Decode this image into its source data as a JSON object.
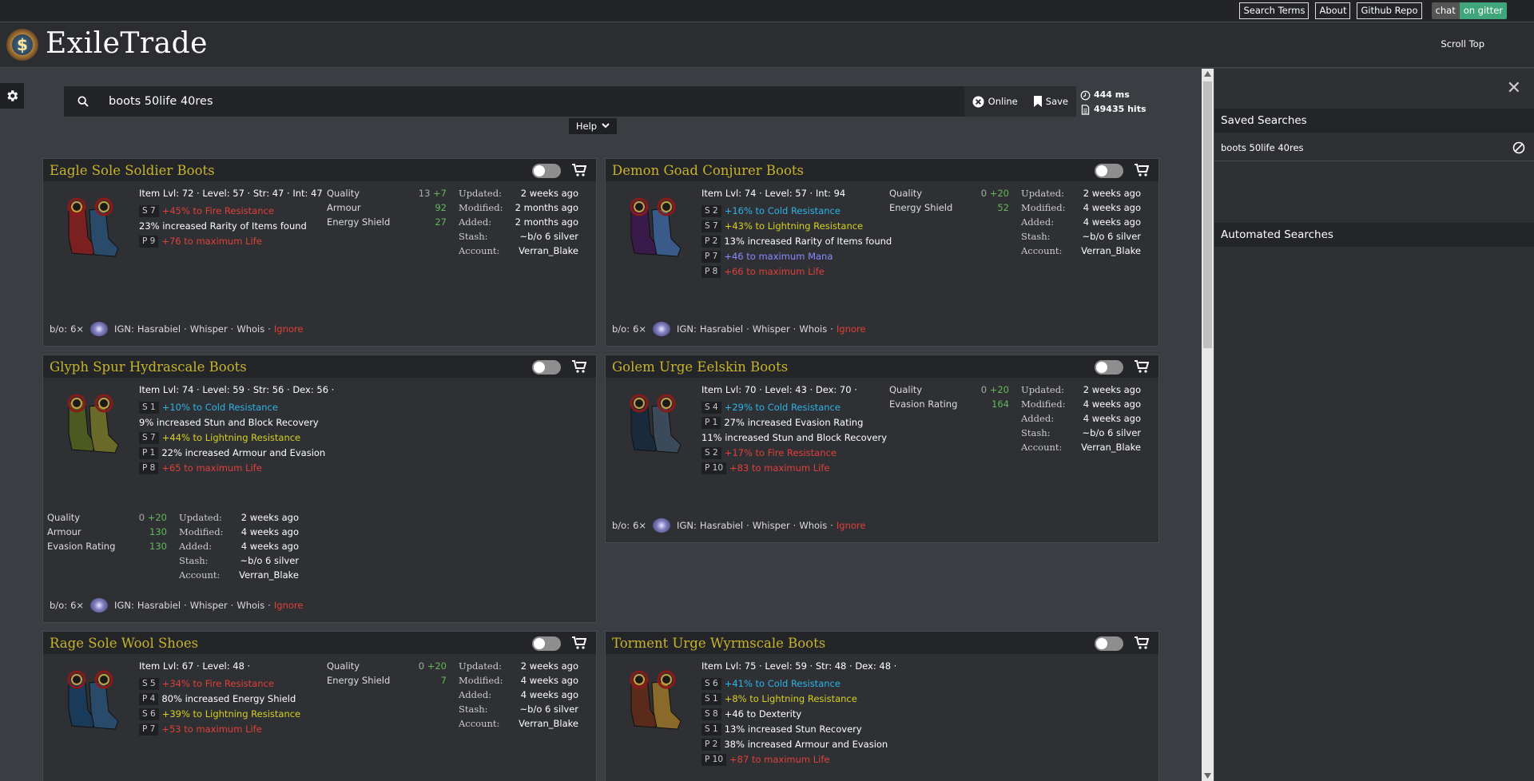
{
  "toplinks": [
    "Search Terms",
    "About",
    "Github Repo"
  ],
  "chat": {
    "left": "chat",
    "right": "on gitter"
  },
  "brand": "ExileTrade",
  "scroll_top": "Scroll Top",
  "search": {
    "value": "boots 50life 40res",
    "online_label": "Online",
    "save_label": "Save"
  },
  "stats": {
    "time": "444 ms",
    "hits": "49435 hits"
  },
  "help_label": "Help",
  "side": {
    "saved_title": "Saved Searches",
    "saved_item": "boots 50life 40res",
    "auto_title": "Automated Searches"
  },
  "colors": {
    "title": "#c8b42a",
    "fire": "#e0403a",
    "cold": "#2db4e8",
    "lightning": "#d8d020",
    "mana": "#8a8aff",
    "quality": "#62b85a"
  },
  "footer": {
    "bo": "b/o:",
    "qty": "6×",
    "ign_label": "IGN:",
    "ign": "Hasrabiel",
    "sep": "·",
    "whisper": "Whisper",
    "whois": "Whois",
    "ignore": "Ignore"
  },
  "cards": [
    {
      "title": "Eagle Sole Soldier Boots",
      "meta": "Item Lvl: 72 · Level: 57 · Str: 47 · Int: 47",
      "mods": [
        {
          "tag": "S 7",
          "text": "+45% to Fire Resistance",
          "cls": "c-fire"
        },
        {
          "tag": "",
          "text": "23% increased Rarity of Items found",
          "cls": "c-white"
        },
        {
          "tag": "P 9",
          "text": "+76 to maximum Life",
          "cls": "c-fire"
        }
      ],
      "quality": [
        {
          "k": "Quality",
          "base": "13",
          "v": "+7"
        },
        {
          "k": "Armour",
          "base": "",
          "v": "92"
        },
        {
          "k": "Energy Shield",
          "base": "",
          "v": "27"
        }
      ],
      "info": [
        {
          "k": "Updated:",
          "v": "2 weeks ago"
        },
        {
          "k": "Modified:",
          "v": "2 months ago"
        },
        {
          "k": "Added:",
          "v": "2 months ago"
        },
        {
          "k": "Stash:",
          "v": "~b/o 6 silver"
        },
        {
          "k": "Account:",
          "v": "Verran_Blake"
        }
      ]
    },
    {
      "title": "Demon Goad Conjurer Boots",
      "meta": "Item Lvl: 74 · Level: 57 · Int: 94",
      "mods": [
        {
          "tag": "S 2",
          "text": "+16% to Cold Resistance",
          "cls": "c-cold"
        },
        {
          "tag": "S 7",
          "text": "+43% to Lightning Resistance",
          "cls": "c-light"
        },
        {
          "tag": "P 2",
          "text": "13% increased Rarity of Items found",
          "cls": "c-white"
        },
        {
          "tag": "P 7",
          "text": "+46 to maximum Mana",
          "cls": "c-mana"
        },
        {
          "tag": "P 8",
          "text": "+66 to maximum Life",
          "cls": "c-fire"
        }
      ],
      "quality": [
        {
          "k": "Quality",
          "base": "0",
          "v": "+20"
        },
        {
          "k": "Energy Shield",
          "base": "",
          "v": "52"
        }
      ],
      "info": [
        {
          "k": "Updated:",
          "v": "2 weeks ago"
        },
        {
          "k": "Modified:",
          "v": "4 weeks ago"
        },
        {
          "k": "Added:",
          "v": "4 weeks ago"
        },
        {
          "k": "Stash:",
          "v": "~b/o 6 silver"
        },
        {
          "k": "Account:",
          "v": "Verran_Blake"
        }
      ]
    },
    {
      "title": "Glyph Spur Hydrascale Boots",
      "meta": "Item Lvl: 74 · Level: 59 · Str: 56 · Dex: 56 ·",
      "mods": [
        {
          "tag": "S 1",
          "text": "+10% to Cold Resistance",
          "cls": "c-cold"
        },
        {
          "tag": "",
          "text": "9% increased Stun and Block Recovery",
          "cls": "c-white"
        },
        {
          "tag": "S 7",
          "text": "+44% to Lightning Resistance",
          "cls": "c-light"
        },
        {
          "tag": "P 1",
          "text": "22% increased Armour and Evasion",
          "cls": "c-white"
        },
        {
          "tag": "P 8",
          "text": "+65 to maximum Life",
          "cls": "c-fire"
        }
      ],
      "quality": [
        {
          "k": "Quality",
          "base": "0",
          "v": "+20"
        },
        {
          "k": "Armour",
          "base": "",
          "v": "130"
        },
        {
          "k": "Evasion Rating",
          "base": "",
          "v": "130"
        }
      ],
      "info": [
        {
          "k": "Updated:",
          "v": "2 weeks ago"
        },
        {
          "k": "Modified:",
          "v": "4 weeks ago"
        },
        {
          "k": "Added:",
          "v": "4 weeks ago"
        },
        {
          "k": "Stash:",
          "v": "~b/o 6 silver"
        },
        {
          "k": "Account:",
          "v": "Verran_Blake"
        }
      ]
    },
    {
      "title": "Golem Urge Eelskin Boots",
      "meta": "Item Lvl: 70 · Level: 43 · Dex: 70 ·",
      "mods": [
        {
          "tag": "S 4",
          "text": "+29% to Cold Resistance",
          "cls": "c-cold"
        },
        {
          "tag": "P 1",
          "text": "27% increased Evasion Rating",
          "cls": "c-white"
        },
        {
          "tag": "",
          "text": "11% increased Stun and Block Recovery",
          "cls": "c-white"
        },
        {
          "tag": "S 2",
          "text": "+17% to Fire Resistance",
          "cls": "c-fire"
        },
        {
          "tag": "P 10",
          "text": "+83 to maximum Life",
          "cls": "c-fire"
        }
      ],
      "quality": [
        {
          "k": "Quality",
          "base": "0",
          "v": "+20"
        },
        {
          "k": "Evasion Rating",
          "base": "",
          "v": "164"
        }
      ],
      "info": [
        {
          "k": "Updated:",
          "v": "2 weeks ago"
        },
        {
          "k": "Modified:",
          "v": "4 weeks ago"
        },
        {
          "k": "Added:",
          "v": "4 weeks ago"
        },
        {
          "k": "Stash:",
          "v": "~b/o 6 silver"
        },
        {
          "k": "Account:",
          "v": "Verran_Blake"
        }
      ]
    },
    {
      "title": "Rage Sole Wool Shoes",
      "meta": "Item Lvl: 67 · Level: 48 ·",
      "mods": [
        {
          "tag": "S 5",
          "text": "+34% to Fire Resistance",
          "cls": "c-fire"
        },
        {
          "tag": "P 4",
          "text": "80% increased Energy Shield",
          "cls": "c-white"
        },
        {
          "tag": "S 6",
          "text": "+39% to Lightning Resistance",
          "cls": "c-light"
        },
        {
          "tag": "P 7",
          "text": "+53 to maximum Life",
          "cls": "c-fire"
        }
      ],
      "quality": [
        {
          "k": "Quality",
          "base": "0",
          "v": "+20"
        },
        {
          "k": "Energy Shield",
          "base": "",
          "v": "7"
        }
      ],
      "info": [
        {
          "k": "Updated:",
          "v": "2 weeks ago"
        },
        {
          "k": "Modified:",
          "v": "4 weeks ago"
        },
        {
          "k": "Added:",
          "v": "4 weeks ago"
        },
        {
          "k": "Stash:",
          "v": "~b/o 6 silver"
        },
        {
          "k": "Account:",
          "v": "Verran_Blake"
        }
      ]
    },
    {
      "title": "Torment Urge Wyrmscale Boots",
      "meta": "Item Lvl: 75 · Level: 59 · Str: 48 · Dex: 48 ·",
      "mods": [
        {
          "tag": "S 6",
          "text": "+41% to Cold Resistance",
          "cls": "c-cold"
        },
        {
          "tag": "S 1",
          "text": "+8% to Lightning Resistance",
          "cls": "c-light"
        },
        {
          "tag": "S 8",
          "text": "+46 to Dexterity",
          "cls": "c-white"
        },
        {
          "tag": "S 1",
          "text": "13% increased Stun Recovery",
          "cls": "c-white"
        },
        {
          "tag": "P 2",
          "text": "38% increased Armour and Evasion",
          "cls": "c-white"
        },
        {
          "tag": "P 10",
          "text": "+87 to maximum Life",
          "cls": "c-fire"
        }
      ],
      "quality": [],
      "info": []
    }
  ]
}
